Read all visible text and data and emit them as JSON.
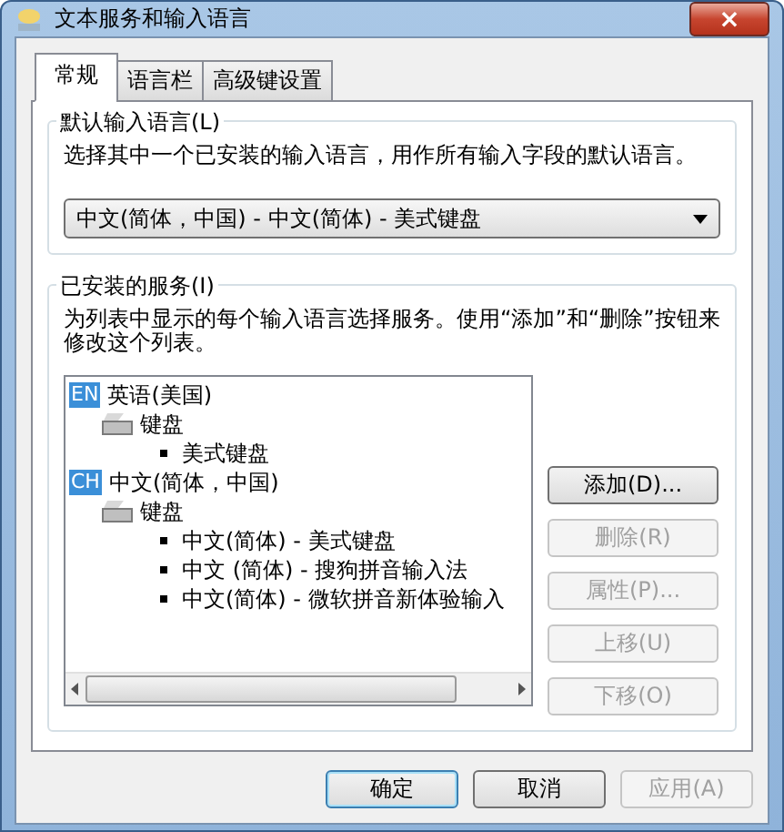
{
  "window": {
    "title": "文本服务和输入语言",
    "close_button": "×"
  },
  "tabs": [
    {
      "label": "常规",
      "selected": true
    },
    {
      "label": "语言栏",
      "selected": false
    },
    {
      "label": "高级键设置",
      "selected": false
    }
  ],
  "default_language": {
    "title": "默认输入语言(L)",
    "description": "选择其中一个已安装的输入语言，用作所有输入字段的默认语言。",
    "dropdown": {
      "value": "中文(简体，中国) - 中文(简体) - 美式键盘"
    }
  },
  "installed_services": {
    "title": "已安装的服务(I)",
    "description": "为列表中显示的每个输入语言选择服务。使用“添加”和“删除”按钮来修改这个列表。",
    "tree": [
      {
        "kind": "language",
        "badge": "EN",
        "label": "英语(美国)",
        "children": [
          {
            "kind": "category",
            "label": "键盘",
            "children": [
              {
                "kind": "service",
                "label": "美式键盘"
              }
            ]
          }
        ]
      },
      {
        "kind": "language",
        "badge": "CH",
        "label": "中文(简体，中国)",
        "children": [
          {
            "kind": "category",
            "label": "键盘",
            "children": [
              {
                "kind": "service",
                "label": "中文(简体) - 美式键盘"
              },
              {
                "kind": "service",
                "label": "中文 (简体) - 搜狗拼音输入法"
              },
              {
                "kind": "service",
                "label": "中文(简体) - 微软拼音新体验输入"
              }
            ]
          }
        ]
      }
    ],
    "buttons": [
      {
        "label": "添加(D)...",
        "disabled": false
      },
      {
        "label": "删除(R)",
        "disabled": true
      },
      {
        "label": "属性(P)...",
        "disabled": true
      },
      {
        "label": "上移(U)",
        "disabled": true
      },
      {
        "label": "下移(O)",
        "disabled": true
      }
    ]
  },
  "footer_buttons": [
    {
      "label": "确定",
      "disabled": false,
      "default": true
    },
    {
      "label": "取消",
      "disabled": false,
      "default": false
    },
    {
      "label": "应用(A)",
      "disabled": true,
      "default": false
    }
  ]
}
